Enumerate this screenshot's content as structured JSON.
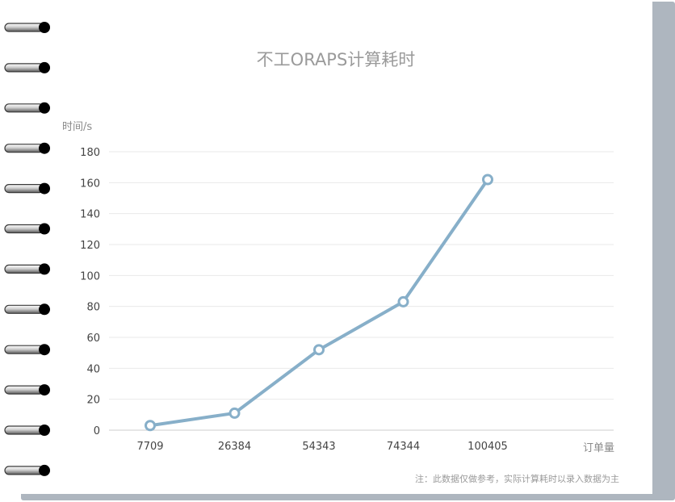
{
  "chart_data": {
    "type": "line",
    "title": "不工ORAPS计算耗时",
    "ylabel": "时间/s",
    "xlabel": "订单量",
    "categories": [
      "7709",
      "26384",
      "54343",
      "74344",
      "100405"
    ],
    "series": [
      {
        "values": [
          3,
          11,
          52,
          83,
          162
        ]
      }
    ],
    "ylim": [
      0,
      180
    ],
    "yticks": [
      0,
      20,
      40,
      60,
      80,
      100,
      120,
      140,
      160,
      180
    ],
    "grid": true,
    "legend": "none",
    "line_color": "#87afc9",
    "note": "注：此数据仅做参考，实际计算耗时以录入数据为主"
  }
}
